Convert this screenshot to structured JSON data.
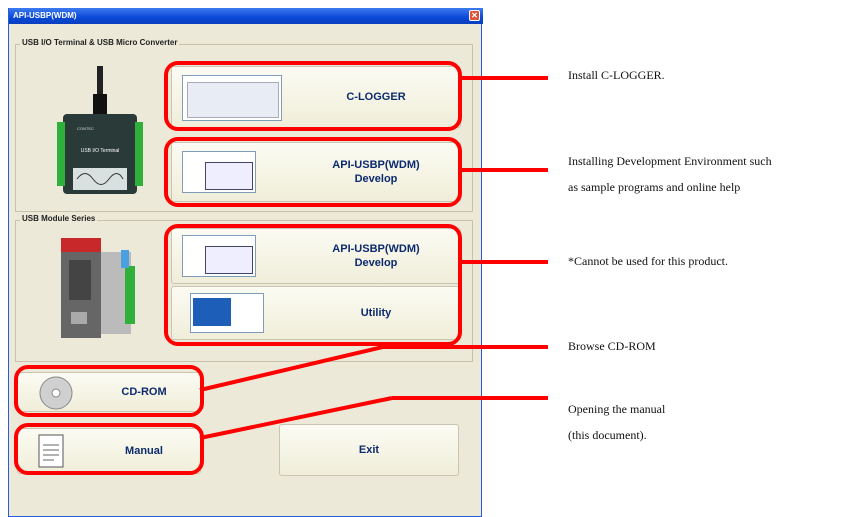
{
  "window": {
    "title": "API-USBP(WDM)",
    "close_glyph": "✕"
  },
  "groups": {
    "usb_io": "USB I/O Terminal & USB Micro Converter",
    "module": "USB Module Series"
  },
  "device_labels": {
    "terminal": "USB I/O Terminal",
    "brand": "CONTEC"
  },
  "buttons": {
    "clogger": "C-LOGGER",
    "develop1_line1": "API-USBP(WDM)",
    "develop1_line2": "Develop",
    "develop2_line1": "API-USBP(WDM)",
    "develop2_line2": "Develop",
    "utility": "Utility",
    "cdrom": "CD-ROM",
    "manual": "Manual",
    "exit": "Exit"
  },
  "annotations": {
    "clogger": "Install C-LOGGER.",
    "develop_line1": "Installing Development Environment such",
    "develop_line2": "as sample programs and online help",
    "module": "*Cannot be used for this product.",
    "cdrom": "Browse CD-ROM",
    "manual_line1": "Opening the manual",
    "manual_line2": "(this document)."
  },
  "colors": {
    "annotation": "#ff0000",
    "title_bar": "#0a48d8"
  }
}
